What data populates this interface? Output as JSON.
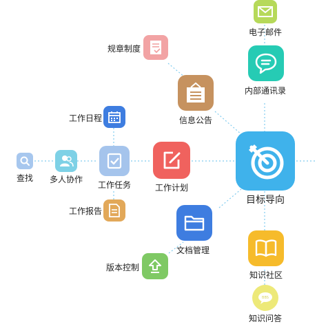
{
  "center": {
    "label": "目标导向",
    "icon": "target-dart-icon",
    "color": "#3FB2EB"
  },
  "nodes": {
    "email": {
      "label": "电子邮件",
      "icon": "envelope-icon",
      "color": "#B6D95A"
    },
    "contacts": {
      "label": "内部通讯录",
      "icon": "chat-bubble-icon",
      "color": "#26CBB4"
    },
    "rules": {
      "label": "规章制度",
      "icon": "document-check-icon",
      "color": "#F2A3A4"
    },
    "notice": {
      "label": "信息公告",
      "icon": "bulletin-board-icon",
      "color": "#C6925F"
    },
    "schedule": {
      "label": "工作日程",
      "icon": "calendar-icon",
      "color": "#3E7DE0"
    },
    "search": {
      "label": "查找",
      "icon": "search-icon",
      "color": "#A7C7EE"
    },
    "collab": {
      "label": "多人协作",
      "icon": "users-icon",
      "color": "#7ED1E6"
    },
    "task": {
      "label": "工作任务",
      "icon": "task-checklist-icon",
      "color": "#A5C4EC"
    },
    "plan": {
      "label": "工作计划",
      "icon": "edit-note-icon",
      "color": "#F0625E"
    },
    "report": {
      "label": "工作报告",
      "icon": "report-doc-icon",
      "color": "#E2A859"
    },
    "docs": {
      "label": "文档管理",
      "icon": "folder-icon",
      "color": "#3E7DE0"
    },
    "version": {
      "label": "版本控制",
      "icon": "upload-arrow-icon",
      "color": "#7FC964"
    },
    "community": {
      "label": "知识社区",
      "icon": "open-book-icon",
      "color": "#F6BB2B"
    },
    "qa": {
      "label": "知识问答",
      "icon": "bbs-bubble-icon",
      "color": "#EDE979"
    }
  },
  "line_color": "#7FCBEF"
}
